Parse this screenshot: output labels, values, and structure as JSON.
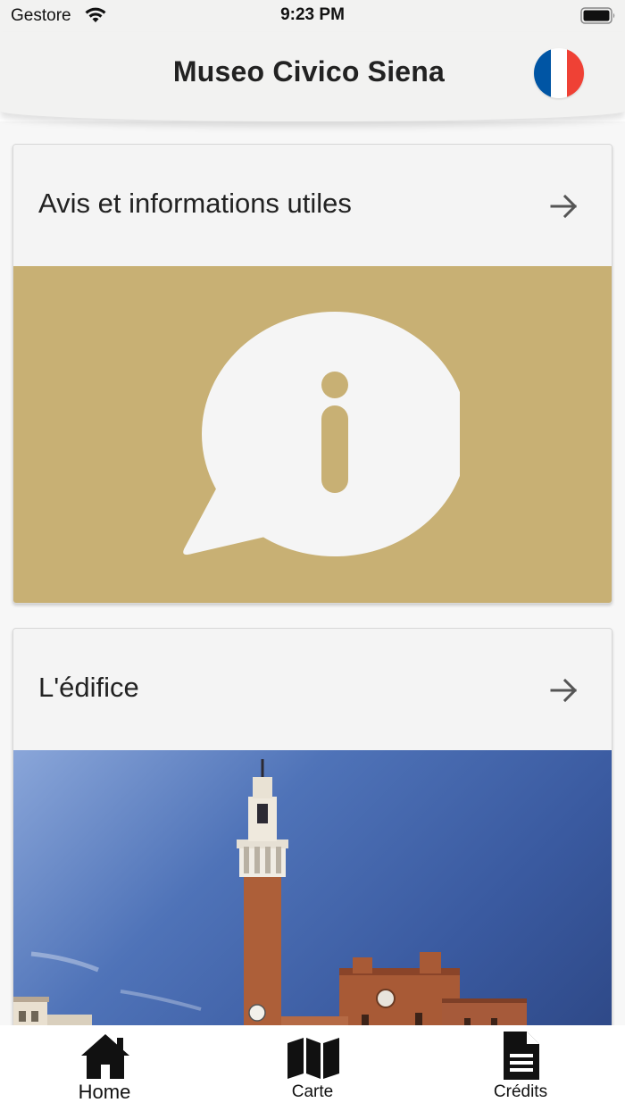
{
  "status_bar": {
    "carrier": "Gestore",
    "time": "9:23 PM"
  },
  "header": {
    "title": "Museo Civico Siena",
    "language_flag": {
      "icon": "flag-france-icon",
      "colors": [
        "#0055A4",
        "#FFFFFF",
        "#EF4135"
      ]
    }
  },
  "cards": [
    {
      "title": "Avis et informations utiles",
      "arrow_icon": "arrow-right-icon",
      "media_icon": "info-speech-bubble-icon",
      "media_background": "#c8b074"
    },
    {
      "title": "L'édifice",
      "arrow_icon": "arrow-right-icon",
      "media": "photo of Palazzo Pubblico and Torre del Mangia"
    }
  ],
  "tab_bar": {
    "tabs": [
      {
        "label": "Home",
        "icon": "home-icon"
      },
      {
        "label": "Carte",
        "icon": "map-icon"
      },
      {
        "label": "Crédits",
        "icon": "document-icon"
      }
    ]
  }
}
